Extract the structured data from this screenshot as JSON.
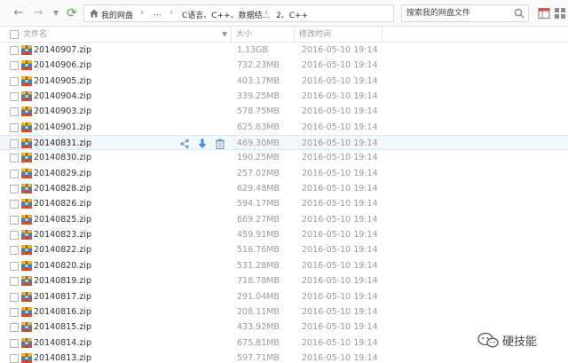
{
  "breadcrumb": {
    "items": [
      "我的网盘",
      "...",
      "C语言、C++、数据结...",
      "2、C++"
    ]
  },
  "search": {
    "placeholder": "搜索我的网盘文件"
  },
  "columns": {
    "name": "文件名",
    "size": "大小",
    "modified": "修改时间"
  },
  "files": [
    {
      "name": "20140907.zip",
      "size": "1.13GB",
      "date": "2016-05-10 19:14"
    },
    {
      "name": "20140906.zip",
      "size": "732.23MB",
      "date": "2016-05-10 19:14"
    },
    {
      "name": "20140905.zip",
      "size": "403.17MB",
      "date": "2016-05-10 19:14"
    },
    {
      "name": "20140904.zip",
      "size": "339.25MB",
      "date": "2016-05-10 19:14"
    },
    {
      "name": "20140903.zip",
      "size": "578.75MB",
      "date": "2016-05-10 19:14"
    },
    {
      "name": "20140901.zip",
      "size": "625.63MB",
      "date": "2016-05-10 19:14"
    },
    {
      "name": "20140831.zip",
      "size": "469.30MB",
      "date": "2016-05-10 19:14"
    },
    {
      "name": "20140830.zip",
      "size": "190.25MB",
      "date": "2016-05-10 19:14"
    },
    {
      "name": "20140829.zip",
      "size": "257.02MB",
      "date": "2016-05-10 19:14"
    },
    {
      "name": "20140828.zip",
      "size": "629.48MB",
      "date": "2016-05-10 19:14"
    },
    {
      "name": "20140826.zip",
      "size": "594.17MB",
      "date": "2016-05-10 19:14"
    },
    {
      "name": "20140825.zip",
      "size": "669.27MB",
      "date": "2016-05-10 19:14"
    },
    {
      "name": "20140823.zip",
      "size": "459.91MB",
      "date": "2016-05-10 19:14"
    },
    {
      "name": "20140822.zip",
      "size": "516.76MB",
      "date": "2016-05-10 19:14"
    },
    {
      "name": "20140820.zip",
      "size": "531.28MB",
      "date": "2016-05-10 19:14"
    },
    {
      "name": "20140819.zip",
      "size": "718.78MB",
      "date": "2016-05-10 19:14"
    },
    {
      "name": "20140817.zip",
      "size": "291.04MB",
      "date": "2016-05-10 19:14"
    },
    {
      "name": "20140816.zip",
      "size": "208.11MB",
      "date": "2016-05-10 19:14"
    },
    {
      "name": "20140815.zip",
      "size": "433.92MB",
      "date": "2016-05-10 19:14"
    },
    {
      "name": "20140814.zip",
      "size": "675.81MB",
      "date": "2016-05-10 19:14"
    },
    {
      "name": "20140813.zip",
      "size": "597.71MB",
      "date": "2016-05-10 19:14"
    }
  ],
  "hover_row_index": 6,
  "row_actions": [
    "share-icon",
    "download-icon",
    "delete-icon"
  ],
  "watermark": {
    "text": "硬技能"
  },
  "colors": {
    "accent": "#3b8de0",
    "refresh": "#58a840",
    "hover": "#f3f8fd"
  }
}
